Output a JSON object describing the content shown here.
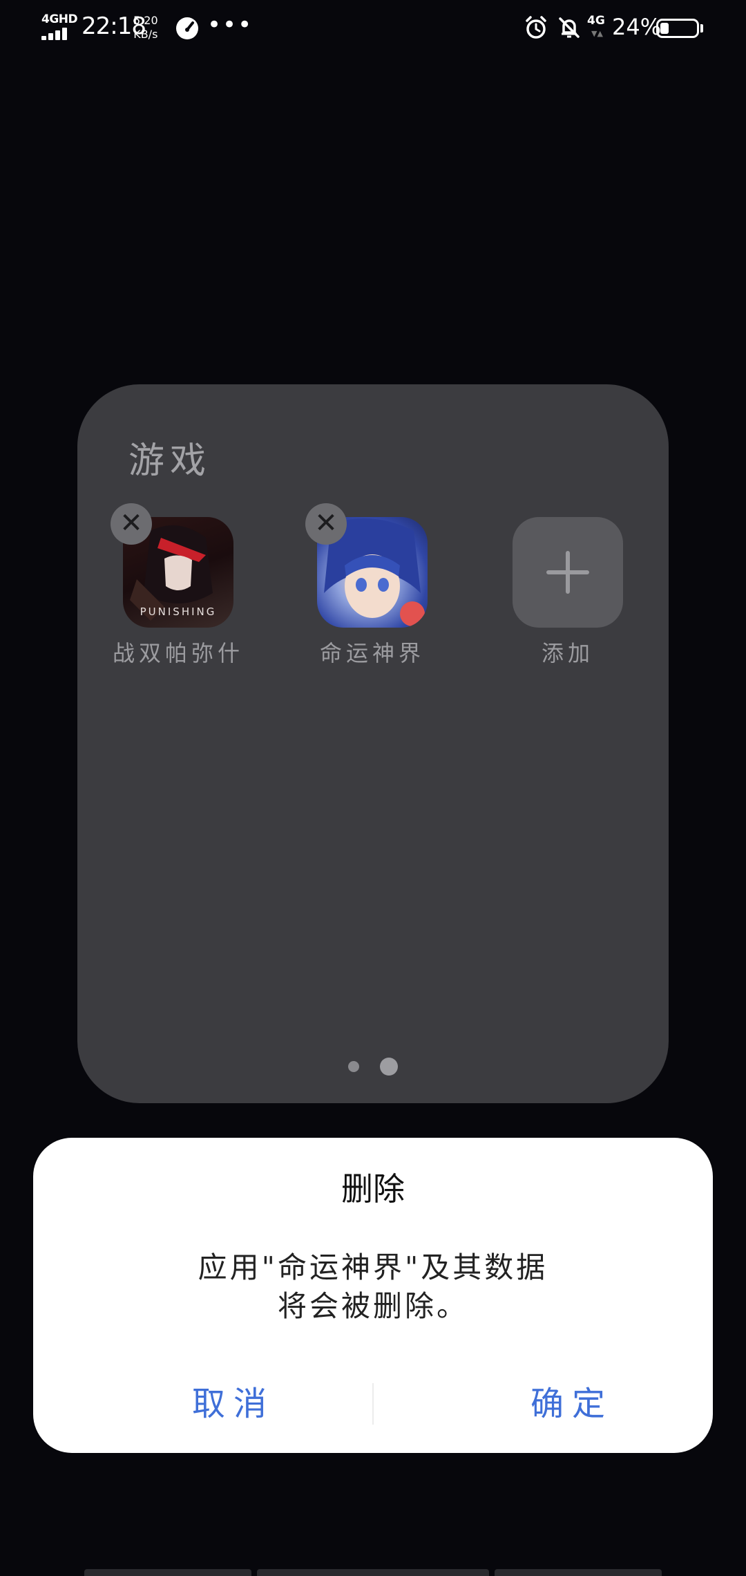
{
  "status_bar": {
    "network_type": "4GHD",
    "time": "22:18",
    "speed_value": "5.20",
    "speed_unit": "KB/s",
    "more_dots": "•••",
    "mobile_data": "4G",
    "battery_percent": "24%",
    "battery_level": 0.24,
    "icons": [
      "signal-icon",
      "speedometer-icon",
      "alarm-icon",
      "mute-icon",
      "battery-icon"
    ]
  },
  "folder": {
    "title": "游戏",
    "apps": [
      {
        "label": "战双帕弥什",
        "icon_text": "PUNISHING",
        "removable": true
      },
      {
        "label": "命运神界",
        "removable": true
      },
      {
        "label": "添加",
        "icon": "plus-icon",
        "removable": false
      }
    ],
    "pages": 2,
    "current_page": 2
  },
  "dialog": {
    "title": "删除",
    "message_line1": "应用\"命运神界\"及其数据",
    "message_line2": "将会被删除。",
    "cancel_label": "取消",
    "confirm_label": "确定",
    "accent_color": "#3f6fd8"
  }
}
